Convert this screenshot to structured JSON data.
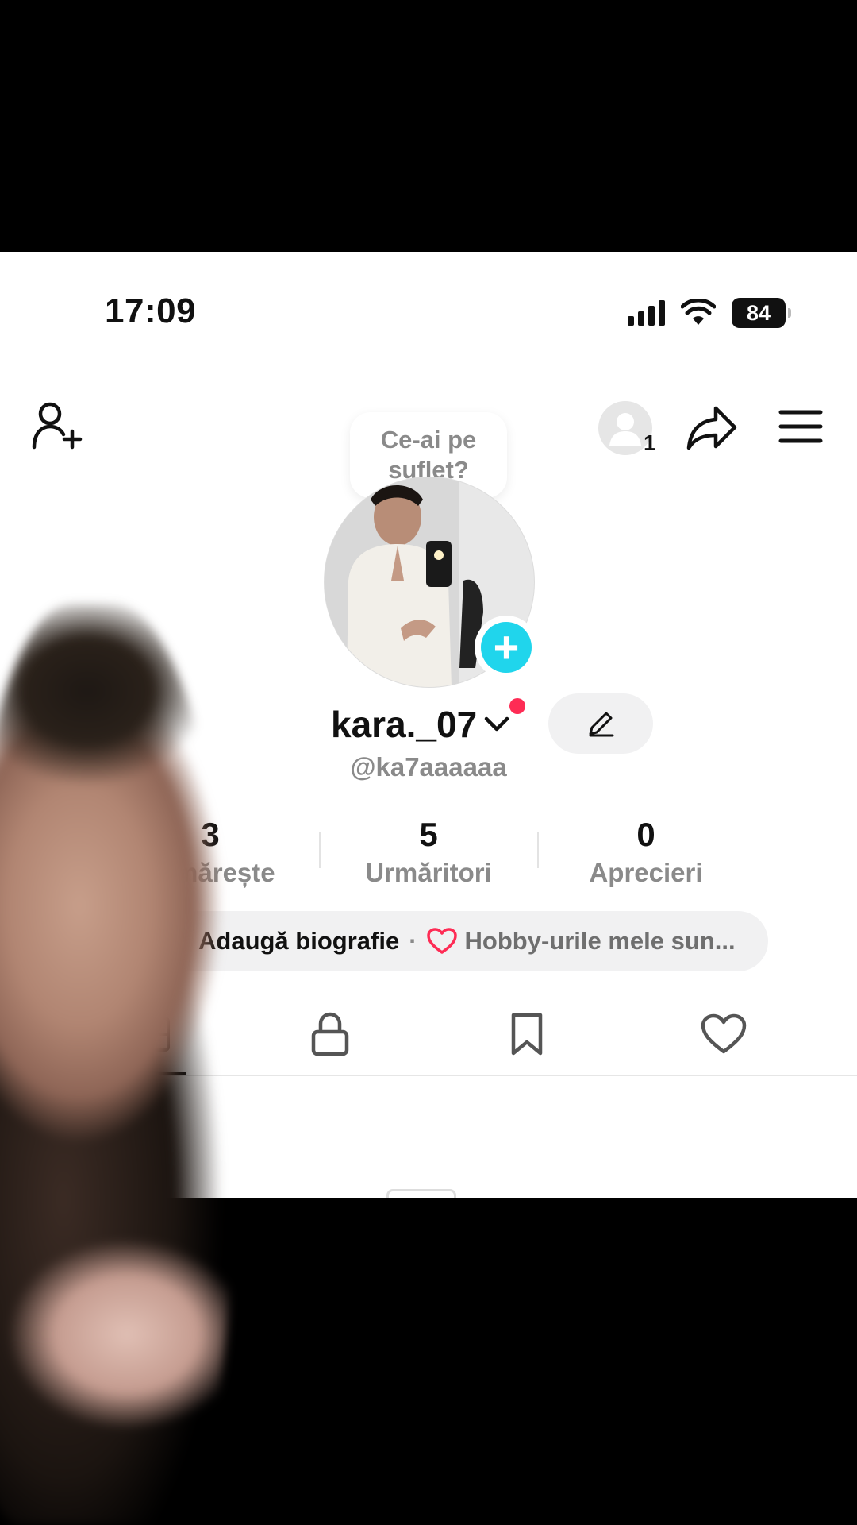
{
  "status_bar": {
    "time": "17:09",
    "battery": "84"
  },
  "header": {
    "bubble_text": "Ce-ai pe suflet?",
    "notification_count": "1"
  },
  "profile": {
    "username": "kara._07",
    "handle": "@ka7aaaaaa",
    "stats": [
      {
        "value": "3",
        "label": "Urmărește"
      },
      {
        "value": "5",
        "label": "Urmăritori"
      },
      {
        "value": "0",
        "label": "Aprecieri"
      }
    ],
    "bio": {
      "add_label": "Adaugă biografie",
      "separator": "·",
      "hobby_text": "Hobby-urile mele sun..."
    }
  },
  "tabs": [
    {
      "name": "videos",
      "icon": "grid-icon"
    },
    {
      "name": "private",
      "icon": "lock-icon"
    },
    {
      "name": "saved",
      "icon": "bookmark-icon"
    },
    {
      "name": "liked",
      "icon": "heart-icon"
    }
  ],
  "colors": {
    "accent_cyan": "#20d5ec",
    "accent_red": "#fe2c55",
    "text_gray": "#8a8a8a"
  }
}
